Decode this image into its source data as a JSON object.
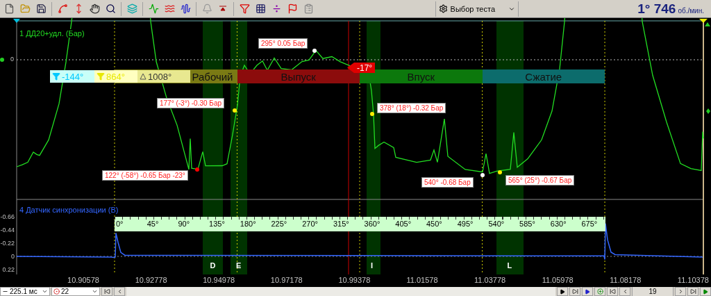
{
  "toolbar": {
    "test_select": {
      "label": "Выбор теста"
    },
    "rpm": {
      "value": "1° 746",
      "unit": "об./мин."
    }
  },
  "top_panel": {
    "title": "1 ДД20+удл. (Бар)",
    "zero_label": "0",
    "cursors": [
      {
        "kind": "start",
        "label": "-144°"
      },
      {
        "kind": "end",
        "label": "864°"
      },
      {
        "kind": "delta",
        "label": "1008°"
      }
    ],
    "phases": [
      {
        "label": "Рабочий",
        "color": "#7a7a14"
      },
      {
        "label": "Выпуск",
        "color": "#8c0c0c"
      },
      {
        "label": "Впуск",
        "color": "#0c780c"
      },
      {
        "label": "Сжатие",
        "color": "#0c6c6c"
      }
    ],
    "marker": {
      "label": "-17°"
    },
    "annotations": [
      {
        "text": "295° 0.05 Бар",
        "color": "#ffffff"
      },
      {
        "text": "177° (-3°) -0.30 Бар",
        "color": "#ffee00"
      },
      {
        "text": "122° (-58°) -0.65 Бар -23°",
        "color": "#ff0000"
      },
      {
        "text": "378° (18°) -0.32 Бар",
        "color": "#ffee00"
      },
      {
        "text": "540° -0.68 Бар",
        "color": "#ffffff"
      },
      {
        "text": "565° (25°) -0.67 Бар",
        "color": "#ffee00"
      }
    ]
  },
  "bottom_panel": {
    "title": "4 Датчик синхронизации (В)",
    "y_ticks": [
      "-0.66",
      "-0.44",
      "-0.22",
      "0",
      "0.22"
    ],
    "angle_scale": [
      "0°",
      "45°",
      "90°",
      "135°",
      "180°",
      "225°",
      "270°",
      "315°",
      "360°",
      "405°",
      "450°",
      "495°",
      "540°",
      "585°",
      "630°",
      "675°"
    ],
    "zones": [
      {
        "label": "D"
      },
      {
        "label": "E"
      },
      {
        "label": "I"
      },
      {
        "label": "L"
      }
    ]
  },
  "time_axis": [
    "10.90578",
    "10.92778",
    "10.94978",
    "10.97178",
    "10.99378",
    "11.01578",
    "11.03778",
    "11.05978",
    "11.08178",
    "11.10378"
  ],
  "status_bar": {
    "timebase": "225.1 мс",
    "channel": "22",
    "page": "19"
  }
}
